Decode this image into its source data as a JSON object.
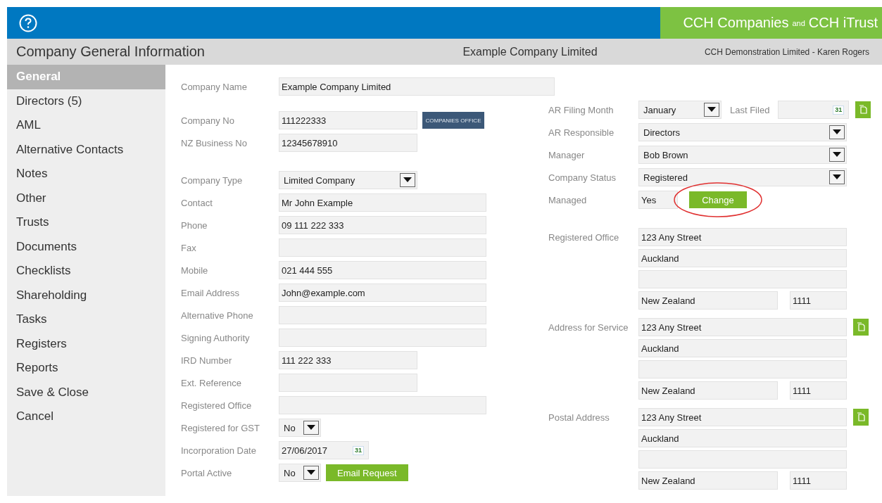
{
  "brand": {
    "first": "CCH Companies",
    "joiner": "and",
    "second": "CCH iTrust"
  },
  "title_bar": {
    "title": "Company General Information",
    "company": "Example Company Limited",
    "user": "CCH Demonstration Limited - Karen Rogers"
  },
  "sidebar": {
    "items": [
      {
        "label": "General",
        "selected": true
      },
      {
        "label": "Directors (5)",
        "selected": false
      },
      {
        "label": "AML",
        "selected": false
      },
      {
        "label": "Alternative Contacts",
        "selected": false
      },
      {
        "label": "Notes",
        "selected": false
      },
      {
        "label": "Other",
        "selected": false
      },
      {
        "label": "Trusts",
        "selected": false
      },
      {
        "label": "Documents",
        "selected": false
      },
      {
        "label": "Checklists",
        "selected": false
      },
      {
        "label": "Shareholding",
        "selected": false
      },
      {
        "label": "Tasks",
        "selected": false
      },
      {
        "label": "Registers",
        "selected": false
      },
      {
        "label": "Reports",
        "selected": false
      },
      {
        "label": "Save & Close",
        "selected": false
      },
      {
        "label": "Cancel",
        "selected": false
      }
    ]
  },
  "left_groups": [
    [
      {
        "label": "Company Name",
        "kind": "long_text",
        "value": "Example Company Limited"
      }
    ],
    [
      {
        "label": "Company No",
        "kind": "short_text",
        "value": "111222333",
        "logo": "COMPANIES OFFICE"
      },
      {
        "label": "NZ Business No",
        "kind": "short_text",
        "value": "12345678910"
      }
    ],
    [
      {
        "label": "Company Type",
        "kind": "select",
        "value": "Limited Company"
      },
      {
        "label": "Contact",
        "kind": "text",
        "value": "Mr John Example"
      },
      {
        "label": "Phone",
        "kind": "text",
        "value": "09 111 222 333"
      },
      {
        "label": "Fax",
        "kind": "text"
      },
      {
        "label": "Mobile",
        "kind": "text",
        "value": "021 444 555"
      },
      {
        "label": "Email Address",
        "kind": "text",
        "value": "John@example.com"
      },
      {
        "label": "Alternative Phone",
        "kind": "text"
      },
      {
        "label": "Signing Authority",
        "kind": "text"
      },
      {
        "label": "IRD Number",
        "kind": "short_text",
        "value": "111 222 333"
      },
      {
        "label": "Ext. Reference",
        "kind": "short_text"
      },
      {
        "label": "Registered Office",
        "kind": "text"
      },
      {
        "label": "Registered for GST",
        "kind": "small_select",
        "value": "No"
      },
      {
        "label": "Incorporation Date",
        "kind": "date",
        "value": "27/06/2017",
        "icon_text": "31"
      },
      {
        "label": "Portal Active",
        "kind": "small_select",
        "value": "No",
        "button": "Email Request"
      }
    ]
  ],
  "right_fields": [
    {
      "label": "AR Filing Month",
      "kind": "select",
      "value": "January",
      "secondary": {
        "label": "Last Filed",
        "kind": "date",
        "icon_text": "31"
      },
      "copy_button": true
    },
    {
      "label": "AR Responsible",
      "kind": "select",
      "value": "Directors"
    },
    {
      "label": "Manager",
      "kind": "select",
      "value": "Bob Brown"
    },
    {
      "label": "Company Status",
      "kind": "select",
      "value": "Registered"
    },
    {
      "label": "Managed",
      "kind": "text",
      "value": "Yes",
      "button": "Change",
      "highlighted": true
    }
  ],
  "addresses": [
    {
      "label": "Registered Office",
      "copy_button": false,
      "lines": [
        "123 Any Street",
        "Auckland"
      ],
      "country": "New Zealand",
      "postcode": "1111"
    },
    {
      "label": "Address for Service",
      "copy_button": true,
      "lines": [
        "123 Any Street",
        "Auckland"
      ],
      "country": "New Zealand",
      "postcode": "1111"
    },
    {
      "label": "Postal Address",
      "copy_button": true,
      "lines": [
        "123 Any Street",
        "Auckland"
      ],
      "country": "New Zealand",
      "postcode": "1111"
    }
  ]
}
